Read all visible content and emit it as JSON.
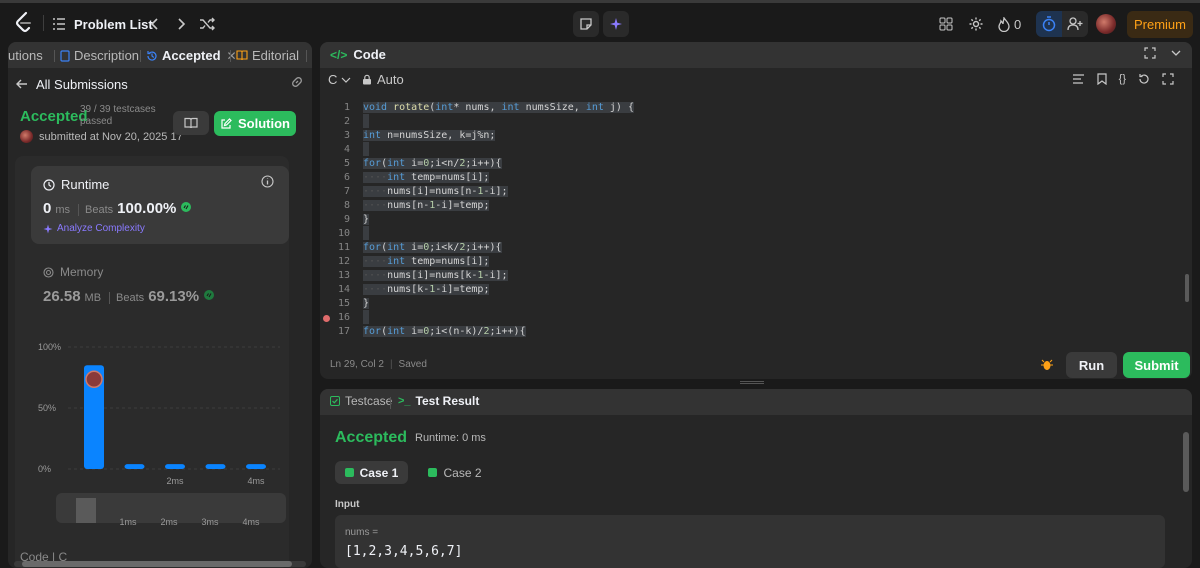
{
  "nav": {
    "problem_list": "Problem List",
    "streak_count": "0",
    "premium": "Premium"
  },
  "left": {
    "tabs": {
      "solutions": "utions",
      "description": "Description",
      "accepted": "Accepted",
      "editorial": "Editorial"
    },
    "all_submissions": "All Submissions",
    "status": "Accepted",
    "testcases": "39 / 39 testcases passed",
    "submitted": "submitted at Nov 20, 2025 17",
    "solution_btn": "Solution",
    "runtime": {
      "label": "Runtime",
      "value": "0",
      "unit": "ms",
      "beats_label": "Beats",
      "beats_value": "100.00%",
      "analyze": "Analyze Complexity"
    },
    "memory": {
      "label": "Memory",
      "value": "26.58",
      "unit": "MB",
      "beats_label": "Beats",
      "beats_value": "69.13%"
    },
    "bottom_hint": "Code | C"
  },
  "chart_data": {
    "type": "bar",
    "y_ticks": [
      "100%",
      "50%",
      "0%"
    ],
    "ylim": [
      0,
      100
    ],
    "values": [
      85,
      4,
      4,
      4,
      4
    ],
    "highlight_index": 0,
    "x_ticks": [
      "2ms",
      "4ms"
    ],
    "mini_ticks": [
      "1ms",
      "2ms",
      "3ms",
      "4ms"
    ]
  },
  "code": {
    "title": "Code",
    "language": "C",
    "mode": "Auto",
    "status_position": "Ln 29, Col 2",
    "status_saved": "Saved",
    "run_btn": "Run",
    "submit_btn": "Submit",
    "lines": [
      {
        "n": "1",
        "t": "void rotate(int* nums, int numsSize, int j) {"
      },
      {
        "n": "2",
        "t": ""
      },
      {
        "n": "3",
        "t": "int n=numsSize, k=j%n;"
      },
      {
        "n": "4",
        "t": ""
      },
      {
        "n": "5",
        "t": "for(int i=0;i<n/2;i++){"
      },
      {
        "n": "6",
        "t": "    int temp=nums[i];"
      },
      {
        "n": "7",
        "t": "    nums[i]=nums[n-1-i];"
      },
      {
        "n": "8",
        "t": "    nums[n-1-i]=temp;"
      },
      {
        "n": "9",
        "t": "}"
      },
      {
        "n": "10",
        "t": ""
      },
      {
        "n": "11",
        "t": "for(int i=0;i<k/2;i++){"
      },
      {
        "n": "12",
        "t": "    int temp=nums[i];"
      },
      {
        "n": "13",
        "t": "    nums[i]=nums[k-1-i];"
      },
      {
        "n": "14",
        "t": "    nums[k-1-i]=temp;"
      },
      {
        "n": "15",
        "t": "}"
      },
      {
        "n": "16",
        "t": ""
      },
      {
        "n": "17",
        "t": "for(int i=0;i<(n-k)/2;i++){"
      }
    ]
  },
  "test": {
    "tab_testcase": "Testcase",
    "tab_result": "Test Result",
    "status": "Accepted",
    "runtime": "Runtime: 0 ms",
    "case1": "Case 1",
    "case2": "Case 2",
    "input_label": "Input",
    "nums_label": "nums =",
    "nums_value": "[1,2,3,4,5,6,7]"
  }
}
